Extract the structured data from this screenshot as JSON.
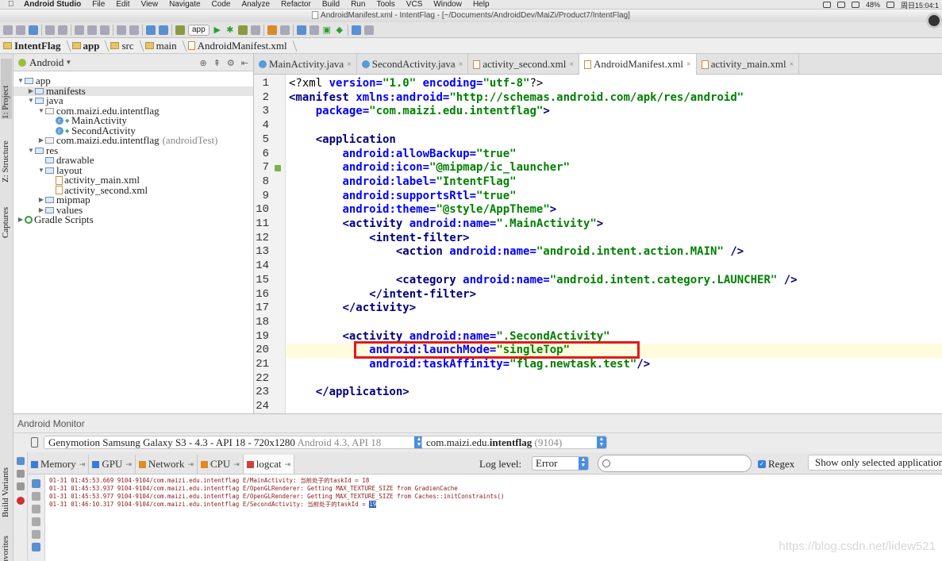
{
  "menubar": {
    "app_name": "Android Studio",
    "items": [
      "File",
      "Edit",
      "View",
      "Navigate",
      "Code",
      "Analyze",
      "Refactor",
      "Build",
      "Run",
      "Tools",
      "VCS",
      "Window",
      "Help"
    ],
    "battery": "48%",
    "clock": "周日15:04:1"
  },
  "window_title": "AndroidManifest.xml - IntentFlag - [~/Documents/AndroidDev/MaiZi/Product7/IntentFlag]",
  "toolbar": {
    "run_config": "app"
  },
  "breadcrumb": [
    "IntentFlag",
    "app",
    "src",
    "main",
    "AndroidManifest.xml"
  ],
  "left_stripe": {
    "project_tab": "1: Project",
    "structure_tab": "Z: Structure",
    "captures_tab": "Captures",
    "build_variants_tab": "Build Variants",
    "favorites_tab": "Favorites"
  },
  "project_panel": {
    "view_mode": "Android",
    "tree": [
      {
        "label": "app",
        "indent": 0,
        "kind": "module",
        "arrow": "▼"
      },
      {
        "label": "manifests",
        "indent": 1,
        "kind": "folder",
        "arrow": "▶",
        "selected": true
      },
      {
        "label": "java",
        "indent": 1,
        "kind": "folder",
        "arrow": "▼"
      },
      {
        "label": "com.maizi.edu.intentflag",
        "indent": 2,
        "kind": "package",
        "arrow": "▼"
      },
      {
        "label": "MainActivity",
        "indent": 3,
        "kind": "class",
        "arrow": ""
      },
      {
        "label": "SecondActivity",
        "indent": 3,
        "kind": "class",
        "arrow": ""
      },
      {
        "label": "com.maizi.edu.intentflag",
        "suffix": "(androidTest)",
        "indent": 2,
        "kind": "package",
        "arrow": "▶"
      },
      {
        "label": "res",
        "indent": 1,
        "kind": "folder",
        "arrow": "▼"
      },
      {
        "label": "drawable",
        "indent": 2,
        "kind": "folder",
        "arrow": ""
      },
      {
        "label": "layout",
        "indent": 2,
        "kind": "folder",
        "arrow": "▼"
      },
      {
        "label": "activity_main.xml",
        "indent": 3,
        "kind": "xml",
        "arrow": ""
      },
      {
        "label": "activity_second.xml",
        "indent": 3,
        "kind": "xml",
        "arrow": ""
      },
      {
        "label": "mipmap",
        "indent": 2,
        "kind": "folder",
        "arrow": "▶"
      },
      {
        "label": "values",
        "indent": 2,
        "kind": "folder",
        "arrow": "▶"
      },
      {
        "label": "Gradle Scripts",
        "indent": 0,
        "kind": "gradle",
        "arrow": "▶"
      }
    ]
  },
  "editor_tabs": [
    {
      "label": "MainActivity.java",
      "kind": "java",
      "active": false
    },
    {
      "label": "SecondActivity.java",
      "kind": "java",
      "active": false
    },
    {
      "label": "activity_second.xml",
      "kind": "xml",
      "active": false
    },
    {
      "label": "AndroidManifest.xml",
      "kind": "xml",
      "active": true
    },
    {
      "label": "activity_main.xml",
      "kind": "xml",
      "active": false
    }
  ],
  "code_lines": [
    [
      [
        "pl",
        "<?xml "
      ],
      [
        "at",
        "version="
      ],
      [
        "av",
        "\"1.0\" "
      ],
      [
        "at",
        "encoding="
      ],
      [
        "av",
        "\"utf-8\""
      ],
      [
        "pl",
        "?>"
      ]
    ],
    [
      [
        "tg",
        "<manifest "
      ],
      [
        "at",
        "xmlns:android="
      ],
      [
        "av",
        "\"http://schemas.android.com/apk/res/android\""
      ]
    ],
    [
      [
        "pl",
        "    "
      ],
      [
        "at",
        "package="
      ],
      [
        "av",
        "\"com.maizi.edu.intentflag\""
      ],
      [
        "tg",
        ">"
      ]
    ],
    [],
    [
      [
        "pl",
        "    "
      ],
      [
        "tg",
        "<application"
      ]
    ],
    [
      [
        "pl",
        "        "
      ],
      [
        "at",
        "android:allowBackup="
      ],
      [
        "av",
        "\"true\""
      ]
    ],
    [
      [
        "pl",
        "        "
      ],
      [
        "at",
        "android:icon="
      ],
      [
        "av",
        "\"@mipmap/ic_launcher\""
      ]
    ],
    [
      [
        "pl",
        "        "
      ],
      [
        "at",
        "android:label="
      ],
      [
        "av",
        "\"IntentFlag\""
      ]
    ],
    [
      [
        "pl",
        "        "
      ],
      [
        "at",
        "android:supportsRtl="
      ],
      [
        "av",
        "\"true\""
      ]
    ],
    [
      [
        "pl",
        "        "
      ],
      [
        "at",
        "android:theme="
      ],
      [
        "av",
        "\"@style/AppTheme\""
      ],
      [
        "tg",
        ">"
      ]
    ],
    [
      [
        "pl",
        "        "
      ],
      [
        "tg",
        "<activity "
      ],
      [
        "at",
        "android:name="
      ],
      [
        "av",
        "\".MainActivity\""
      ],
      [
        "tg",
        ">"
      ]
    ],
    [
      [
        "pl",
        "            "
      ],
      [
        "tg",
        "<intent-filter>"
      ]
    ],
    [
      [
        "pl",
        "                "
      ],
      [
        "tg",
        "<action "
      ],
      [
        "at",
        "android:name="
      ],
      [
        "av",
        "\"android.intent.action.MAIN\""
      ],
      [
        "tg",
        " />"
      ]
    ],
    [],
    [
      [
        "pl",
        "                "
      ],
      [
        "tg",
        "<category "
      ],
      [
        "at",
        "android:name="
      ],
      [
        "av",
        "\"android.intent.category.LAUNCHER\""
      ],
      [
        "tg",
        " />"
      ]
    ],
    [
      [
        "pl",
        "            "
      ],
      [
        "tg",
        "</intent-filter>"
      ]
    ],
    [
      [
        "pl",
        "        "
      ],
      [
        "tg",
        "</activity>"
      ]
    ],
    [],
    [
      [
        "pl",
        "        "
      ],
      [
        "tg",
        "<activity "
      ],
      [
        "at",
        "android:name="
      ],
      [
        "av",
        "\".SecondActivity\""
      ]
    ],
    [
      [
        "pl",
        "            "
      ],
      [
        "at",
        "android:launchMode="
      ],
      [
        "av",
        "\"singleTop\""
      ]
    ],
    [
      [
        "pl",
        "            "
      ],
      [
        "at",
        "android:taskAffinity="
      ],
      [
        "av",
        "\"flag.newtask.test\""
      ],
      [
        "tg",
        "/>"
      ]
    ],
    [],
    [
      [
        "pl",
        "    "
      ],
      [
        "tg",
        "</application>"
      ]
    ],
    []
  ],
  "monitor": {
    "title": "Android Monitor",
    "device": "Genymotion Samsung Galaxy S3 - 4.3 - API 18 - 720x1280",
    "device_suffix": "Android 4.3, API 18",
    "process_name": "com.maizi.edu.",
    "process_bold": "intentflag",
    "process_pid": "(9104)",
    "tabs": [
      {
        "label": "Memory",
        "active": false,
        "color": "#3a7bd5"
      },
      {
        "label": "GPU",
        "active": false,
        "color": "#3a7bd5"
      },
      {
        "label": "Network",
        "active": false,
        "color": "#e08a20"
      },
      {
        "label": "CPU",
        "active": false,
        "color": "#e08a20"
      },
      {
        "label": "logcat",
        "active": true,
        "color": "#d04040"
      }
    ],
    "log_level_label": "Log level:",
    "log_level": "Error",
    "search_placeholder": "",
    "regex_label": "Regex",
    "regex_checked": true,
    "show_only": "Show only selected application",
    "log_lines": [
      "01-31 01:45:53.669 9104-9104/com.maizi.edu.intentflag E/MainActivity: 当前处于的taskId = 18",
      "01-31 01:45:53.937 9104-9104/com.maizi.edu.intentflag E/OpenGLRenderer: Getting MAX_TEXTURE_SIZE from GradienCache",
      "01-31 01:45:53.977 9104-9104/com.maizi.edu.intentflag E/OpenGLRenderer: Getting MAX_TEXTURE_SIZE from Caches::initConstraints()",
      "01-31 01:46:10.317 9104-9104/com.maizi.edu.intentflag E/SecondActivity: 当前处于的taskId = "
    ],
    "last_log_selected": "19"
  },
  "watermark": "https://blog.csdn.net/lidew521"
}
